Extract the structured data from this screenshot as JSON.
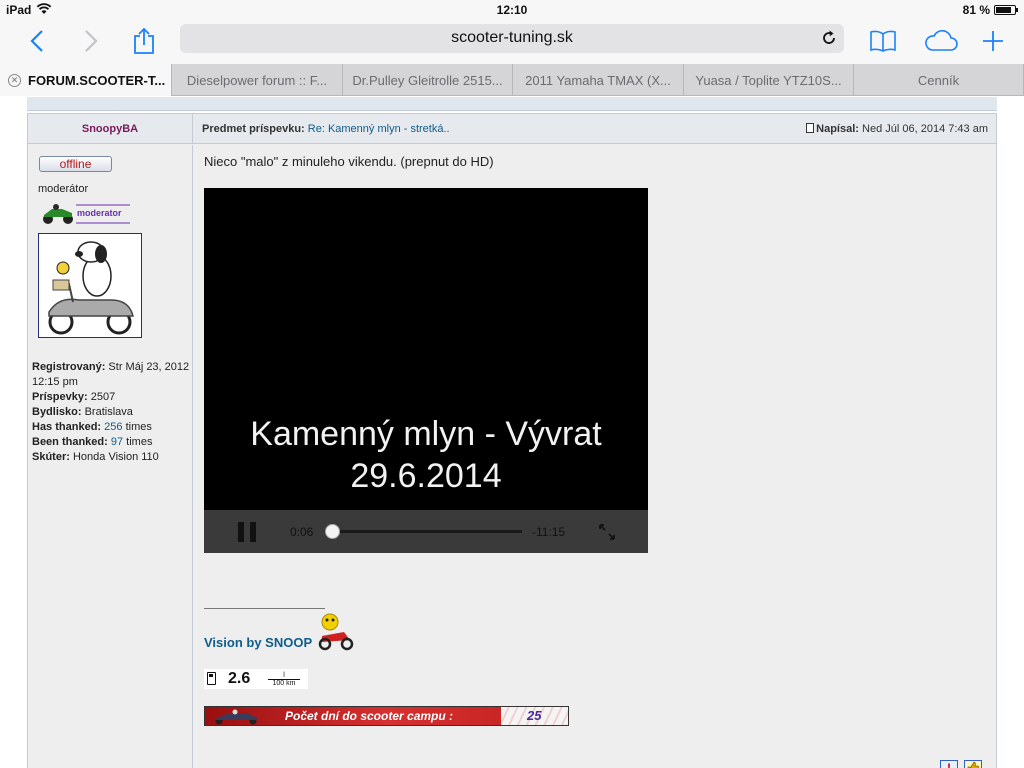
{
  "status_bar": {
    "device": "iPad",
    "time": "12:10",
    "battery": "81 %",
    "battery_level": 0.81
  },
  "browser": {
    "url": "scooter-tuning.sk",
    "tabs": [
      {
        "label": "FORUM.SCOOTER-T...",
        "active": true
      },
      {
        "label": "Dieselpower forum :: F...",
        "active": false
      },
      {
        "label": "Dr.Pulley Gleitrolle 2515...",
        "active": false
      },
      {
        "label": "2011 Yamaha TMAX (X...",
        "active": false
      },
      {
        "label": "Yuasa / Toplite YTZ10S...",
        "active": false
      },
      {
        "label": "Cenník",
        "active": false
      }
    ]
  },
  "post": {
    "author": "SnoopyBA",
    "subject_label": "Predmet príspevku:",
    "subject": "Re: Kamenný mlyn - stretká..",
    "posted_label": "Napísal:",
    "posted_date": "Ned Júl 06, 2014 7:43 am",
    "body_text": "Nieco \"malo\" z minuleho vikendu. (prepnut do HD)"
  },
  "profile": {
    "status_button": "offline",
    "role": "moderátor",
    "role_badge": "moderator",
    "registered_label": "Registrovaný:",
    "registered": "Str Máj 23, 2012 12:15 pm",
    "posts_label": "Príspevky:",
    "posts": "2507",
    "location_label": "Bydlisko:",
    "location": "Bratislava",
    "has_thanked_label": "Has thanked:",
    "has_thanked": "256",
    "been_thanked_label": "Been thanked:",
    "been_thanked": "97",
    "times": "times",
    "scooter_label": "Skúter:",
    "scooter": "Honda Vision 110"
  },
  "video": {
    "title_line1": "Kamenný mlyn - Vývrat",
    "title_line2": "29.6.2014",
    "current_time": "0:06",
    "remaining_time": "-11:15",
    "progress": 0.01
  },
  "signature": {
    "line": "_________________",
    "text": "Vision by SNOOP",
    "fuel_value": "2.6",
    "fuel_unit_top": "l",
    "fuel_unit_bottom": "100 km",
    "banner_text": "Počet dní do scooter campu :",
    "banner_count": "25"
  },
  "colors": {
    "accent": "#1a82fb",
    "link": "#0f5d8a",
    "author": "#7a1a5a"
  }
}
